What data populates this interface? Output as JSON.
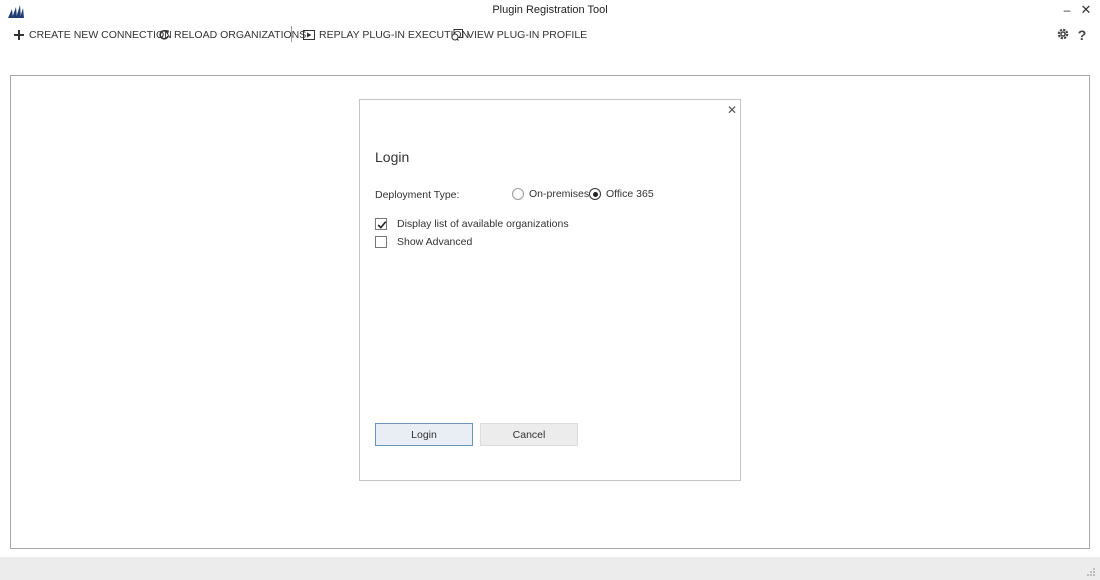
{
  "window": {
    "title": "Plugin Registration Tool",
    "minimize_label": "–",
    "close_label": "✕"
  },
  "toolbar": {
    "create_new_connection": "CREATE NEW CONNECTION",
    "reload_organizations": "RELOAD ORGANIZATIONS",
    "replay_plugin_execution": "REPLAY PLUG-IN EXECUTION",
    "view_plugin_profile": "VIEW PLUG-IN PROFILE",
    "icons": {
      "create": "plus-icon",
      "reload": "refresh-icon",
      "replay": "play-icon",
      "profile": "profile-icon",
      "settings": "gear-icon",
      "help": "help-icon"
    }
  },
  "login_dialog": {
    "title": "Login",
    "close_label": "✕",
    "deployment_type_label": "Deployment Type:",
    "options": [
      {
        "label": "On-premises",
        "checked": false
      },
      {
        "label": "Office 365",
        "checked": true
      }
    ],
    "checkboxes": [
      {
        "label": "Display list of available organizations",
        "checked": true
      },
      {
        "label": "Show Advanced",
        "checked": false
      }
    ],
    "login_button": "Login",
    "cancel_button": "Cancel"
  },
  "colors": {
    "brand_logo": "#1f3f73",
    "login_button_border": "#6e93b8",
    "statusbar_bg": "#ececec"
  }
}
